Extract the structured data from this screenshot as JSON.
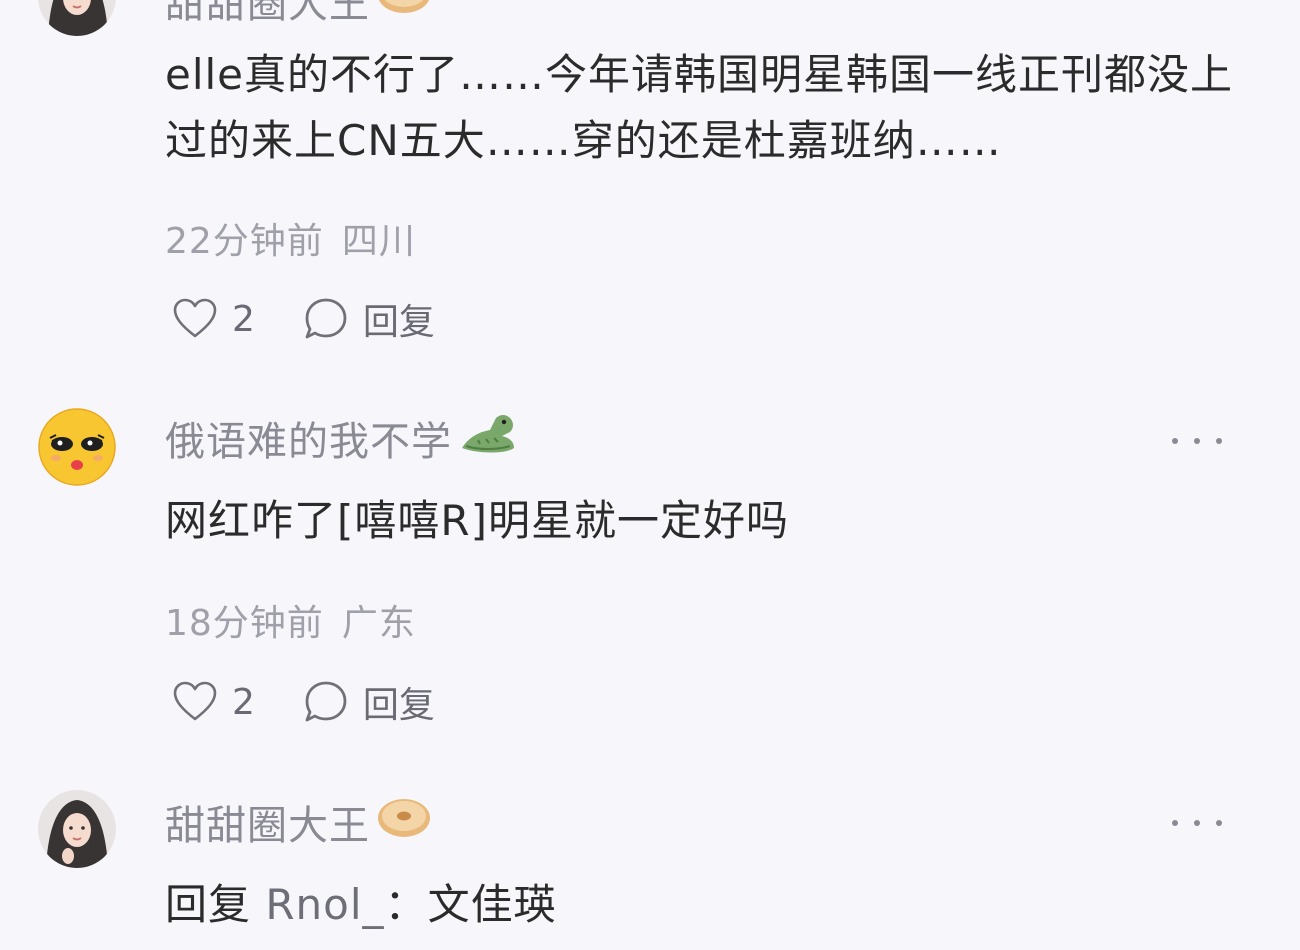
{
  "comments": [
    {
      "author": "甜甜圈大王",
      "text": "elle真的不行了……今年请韩国明星韩国一线正刊都没上过的来上CN五大……穿的还是杜嘉班纳……",
      "time": "22分钟前",
      "location": "四川",
      "likes": "2",
      "reply_label": "回复",
      "avatar_icon": "avatar-photo",
      "badge_icon": "donut-icon"
    },
    {
      "author": "俄语难的我不学",
      "text": "网红咋了[嘻嘻R]明星就一定好吗",
      "time": "18分钟前",
      "location": "广东",
      "likes": "2",
      "reply_label": "回复",
      "avatar_icon": "emoji-face-avatar",
      "badge_icon": "crocodile-icon"
    },
    {
      "author": "甜甜圈大王",
      "reply_prefix": "回复",
      "reply_target": "Rnol_",
      "reply_sep": "：",
      "text": "文佳瑛",
      "avatar_icon": "avatar-photo",
      "badge_icon": "donut-icon"
    }
  ],
  "colors": {
    "background": "#f7f7fb",
    "author": "#8a8a94",
    "text": "#2b2b2b",
    "meta": "#a0a0aa"
  }
}
